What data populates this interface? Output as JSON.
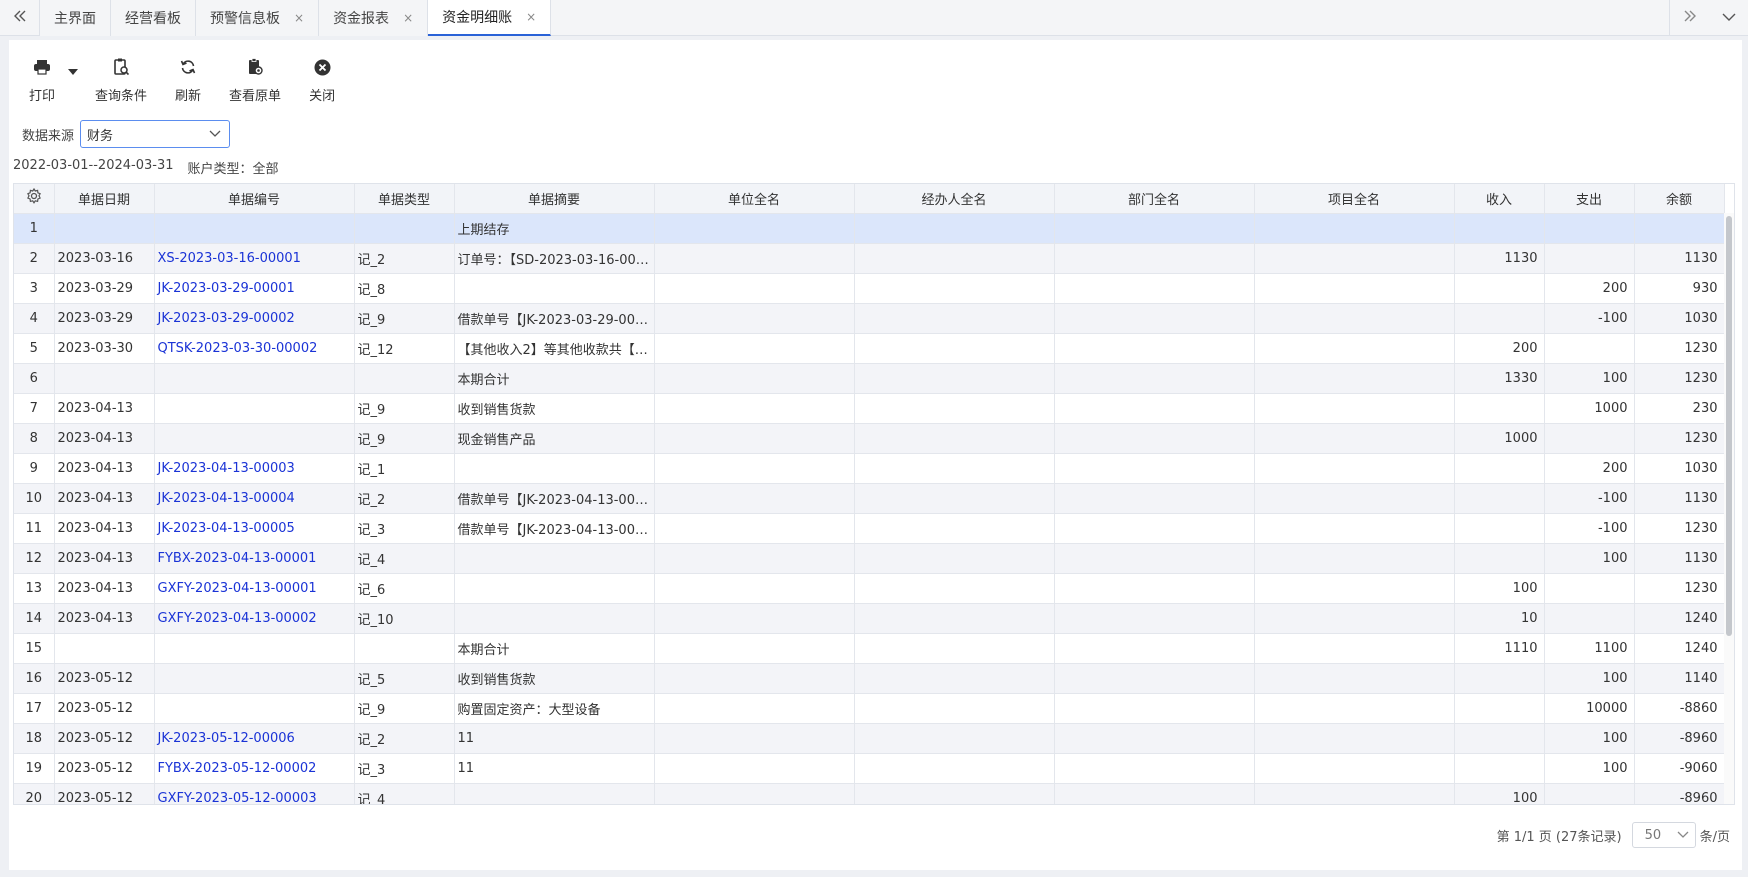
{
  "tabs": [
    {
      "label": "主界面",
      "closable": false,
      "active": false
    },
    {
      "label": "经营看板",
      "closable": false,
      "active": false
    },
    {
      "label": "预警信息板",
      "closable": true,
      "active": false
    },
    {
      "label": "资金报表",
      "closable": true,
      "active": false
    },
    {
      "label": "资金明细账",
      "closable": true,
      "active": true
    }
  ],
  "toolbar": {
    "print": "打印",
    "query": "查询条件",
    "refresh": "刷新",
    "view_original": "查看原单",
    "close": "关闭"
  },
  "filter": {
    "source_label": "数据来源",
    "source_value": "财务",
    "date_range": "2022-03-01--2024-03-31",
    "account_type": "账户类型：全部"
  },
  "table": {
    "columns": [
      "单据日期",
      "单据编号",
      "单据类型",
      "单据摘要",
      "单位全名",
      "经办人全名",
      "部门全名",
      "项目全名",
      "收入",
      "支出",
      "余额"
    ],
    "rows": [
      {
        "idx": "1",
        "date": "",
        "code": "",
        "type": "",
        "summary": "上期结存",
        "unit": "",
        "handler": "",
        "dept": "",
        "project": "",
        "income": "",
        "expense": "",
        "balance": ""
      },
      {
        "idx": "2",
        "date": "2023-03-16",
        "code": "XS-2023-03-16-00001",
        "type": "记_2",
        "summary": "订单号：【SD-2023-03-16-000...",
        "unit": "",
        "handler": "",
        "dept": "",
        "project": "",
        "income": "1130",
        "expense": "",
        "balance": "1130"
      },
      {
        "idx": "3",
        "date": "2023-03-29",
        "code": "JK-2023-03-29-00001",
        "type": "记_8",
        "summary": "",
        "unit": "",
        "handler": "",
        "dept": "",
        "project": "",
        "income": "",
        "expense": "200",
        "balance": "930"
      },
      {
        "idx": "4",
        "date": "2023-03-29",
        "code": "JK-2023-03-29-00002",
        "type": "记_9",
        "summary": "借款单号【JK-2023-03-29-0000...",
        "unit": "",
        "handler": "",
        "dept": "",
        "project": "",
        "income": "",
        "expense": "-100",
        "balance": "1030"
      },
      {
        "idx": "5",
        "date": "2023-03-30",
        "code": "QTSK-2023-03-30-00002",
        "type": "记_12",
        "summary": "【其他收入2】等其他收款共【11...",
        "unit": "",
        "handler": "",
        "dept": "",
        "project": "",
        "income": "200",
        "expense": "",
        "balance": "1230"
      },
      {
        "idx": "6",
        "date": "",
        "code": "",
        "type": "",
        "summary": "本期合计",
        "unit": "",
        "handler": "",
        "dept": "",
        "project": "",
        "income": "1330",
        "expense": "100",
        "balance": "1230"
      },
      {
        "idx": "7",
        "date": "2023-04-13",
        "code": "",
        "type": "记_9",
        "summary": "收到销售货款",
        "unit": "",
        "handler": "",
        "dept": "",
        "project": "",
        "income": "",
        "expense": "1000",
        "balance": "230"
      },
      {
        "idx": "8",
        "date": "2023-04-13",
        "code": "",
        "type": "记_9",
        "summary": "现金销售产品",
        "unit": "",
        "handler": "",
        "dept": "",
        "project": "",
        "income": "1000",
        "expense": "",
        "balance": "1230"
      },
      {
        "idx": "9",
        "date": "2023-04-13",
        "code": "JK-2023-04-13-00003",
        "type": "记_1",
        "summary": "",
        "unit": "",
        "handler": "",
        "dept": "",
        "project": "",
        "income": "",
        "expense": "200",
        "balance": "1030"
      },
      {
        "idx": "10",
        "date": "2023-04-13",
        "code": "JK-2023-04-13-00004",
        "type": "记_2",
        "summary": "借款单号【JK-2023-04-13-0000...",
        "unit": "",
        "handler": "",
        "dept": "",
        "project": "",
        "income": "",
        "expense": "-100",
        "balance": "1130"
      },
      {
        "idx": "11",
        "date": "2023-04-13",
        "code": "JK-2023-04-13-00005",
        "type": "记_3",
        "summary": "借款单号【JK-2023-04-13-0000...",
        "unit": "",
        "handler": "",
        "dept": "",
        "project": "",
        "income": "",
        "expense": "-100",
        "balance": "1230"
      },
      {
        "idx": "12",
        "date": "2023-04-13",
        "code": "FYBX-2023-04-13-00001",
        "type": "记_4",
        "summary": "",
        "unit": "",
        "handler": "",
        "dept": "",
        "project": "",
        "income": "",
        "expense": "100",
        "balance": "1130"
      },
      {
        "idx": "13",
        "date": "2023-04-13",
        "code": "GXFY-2023-04-13-00001",
        "type": "记_6",
        "summary": "",
        "unit": "",
        "handler": "",
        "dept": "",
        "project": "",
        "income": "100",
        "expense": "",
        "balance": "1230"
      },
      {
        "idx": "14",
        "date": "2023-04-13",
        "code": "GXFY-2023-04-13-00002",
        "type": "记_10",
        "summary": "",
        "unit": "",
        "handler": "",
        "dept": "",
        "project": "",
        "income": "10",
        "expense": "",
        "balance": "1240"
      },
      {
        "idx": "15",
        "date": "",
        "code": "",
        "type": "",
        "summary": "本期合计",
        "unit": "",
        "handler": "",
        "dept": "",
        "project": "",
        "income": "1110",
        "expense": "1100",
        "balance": "1240"
      },
      {
        "idx": "16",
        "date": "2023-05-12",
        "code": "",
        "type": "记_5",
        "summary": "收到销售货款",
        "unit": "",
        "handler": "",
        "dept": "",
        "project": "",
        "income": "",
        "expense": "100",
        "balance": "1140"
      },
      {
        "idx": "17",
        "date": "2023-05-12",
        "code": "",
        "type": "记_9",
        "summary": "购置固定资产：大型设备",
        "unit": "",
        "handler": "",
        "dept": "",
        "project": "",
        "income": "",
        "expense": "10000",
        "balance": "-8860"
      },
      {
        "idx": "18",
        "date": "2023-05-12",
        "code": "JK-2023-05-12-00006",
        "type": "记_2",
        "summary": "11",
        "unit": "",
        "handler": "",
        "dept": "",
        "project": "",
        "income": "",
        "expense": "100",
        "balance": "-8960"
      },
      {
        "idx": "19",
        "date": "2023-05-12",
        "code": "FYBX-2023-05-12-00002",
        "type": "记_3",
        "summary": "11",
        "unit": "",
        "handler": "",
        "dept": "",
        "project": "",
        "income": "",
        "expense": "100",
        "balance": "-9060"
      },
      {
        "idx": "20",
        "date": "2023-05-12",
        "code": "GXFY-2023-05-12-00003",
        "type": "记_4",
        "summary": "",
        "unit": "",
        "handler": "",
        "dept": "",
        "project": "",
        "income": "100",
        "expense": "",
        "balance": "-8960"
      }
    ]
  },
  "pager": {
    "summary": "第 1/1 页 (27条记录)",
    "page_size": "50",
    "unit": "条/页"
  },
  "colors": {
    "link": "#1a33d6",
    "accent": "#2a62d7",
    "selected_row": "#dbe6fb"
  }
}
